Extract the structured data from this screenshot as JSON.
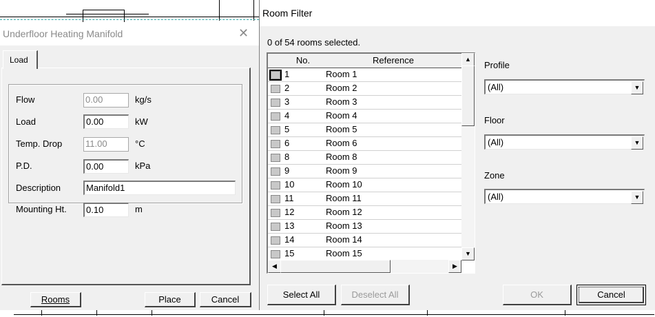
{
  "manifold": {
    "title": "Underfloor Heating Manifold",
    "close_glyph": "✕",
    "tab_label": "Load",
    "fields": [
      {
        "label": "Flow",
        "value": "0.00",
        "unit": "kg/s",
        "enabled": false
      },
      {
        "label": "Load",
        "value": "0.00",
        "unit": "kW",
        "enabled": true
      },
      {
        "label": "Temp. Drop",
        "value": "11.00",
        "unit": "°C",
        "enabled": false
      },
      {
        "label": "P.D.",
        "value": "0.00",
        "unit": "kPa",
        "enabled": true
      },
      {
        "label": "Description",
        "value": "Manifold1",
        "unit": "",
        "enabled": true
      },
      {
        "label": "Mounting Ht.",
        "value": "0.10",
        "unit": "m",
        "enabled": true
      }
    ],
    "buttons": {
      "rooms": "Rooms",
      "place": "Place",
      "cancel": "Cancel"
    }
  },
  "room_filter": {
    "title": "Room Filter",
    "selection_status": "0 of 54 rooms selected.",
    "columns": {
      "no": "No.",
      "reference": "Reference"
    },
    "rows": [
      {
        "no": "1",
        "reference": "Room 1"
      },
      {
        "no": "2",
        "reference": "Room 2"
      },
      {
        "no": "3",
        "reference": "Room 3"
      },
      {
        "no": "4",
        "reference": "Room 4"
      },
      {
        "no": "5",
        "reference": "Room 5"
      },
      {
        "no": "6",
        "reference": "Room 6"
      },
      {
        "no": "8",
        "reference": "Room 8"
      },
      {
        "no": "9",
        "reference": "Room 9"
      },
      {
        "no": "10",
        "reference": "Room 10"
      },
      {
        "no": "11",
        "reference": "Room 11"
      },
      {
        "no": "12",
        "reference": "Room 12"
      },
      {
        "no": "13",
        "reference": "Room 13"
      },
      {
        "no": "14",
        "reference": "Room 14"
      },
      {
        "no": "15",
        "reference": "Room 15"
      }
    ],
    "filters": [
      {
        "label": "Profile",
        "value": "(All)"
      },
      {
        "label": "Floor",
        "value": "(All)"
      },
      {
        "label": "Zone",
        "value": "(All)"
      }
    ],
    "buttons": {
      "select_all": "Select All",
      "deselect_all": "Deselect All",
      "ok": "OK",
      "cancel": "Cancel"
    }
  }
}
